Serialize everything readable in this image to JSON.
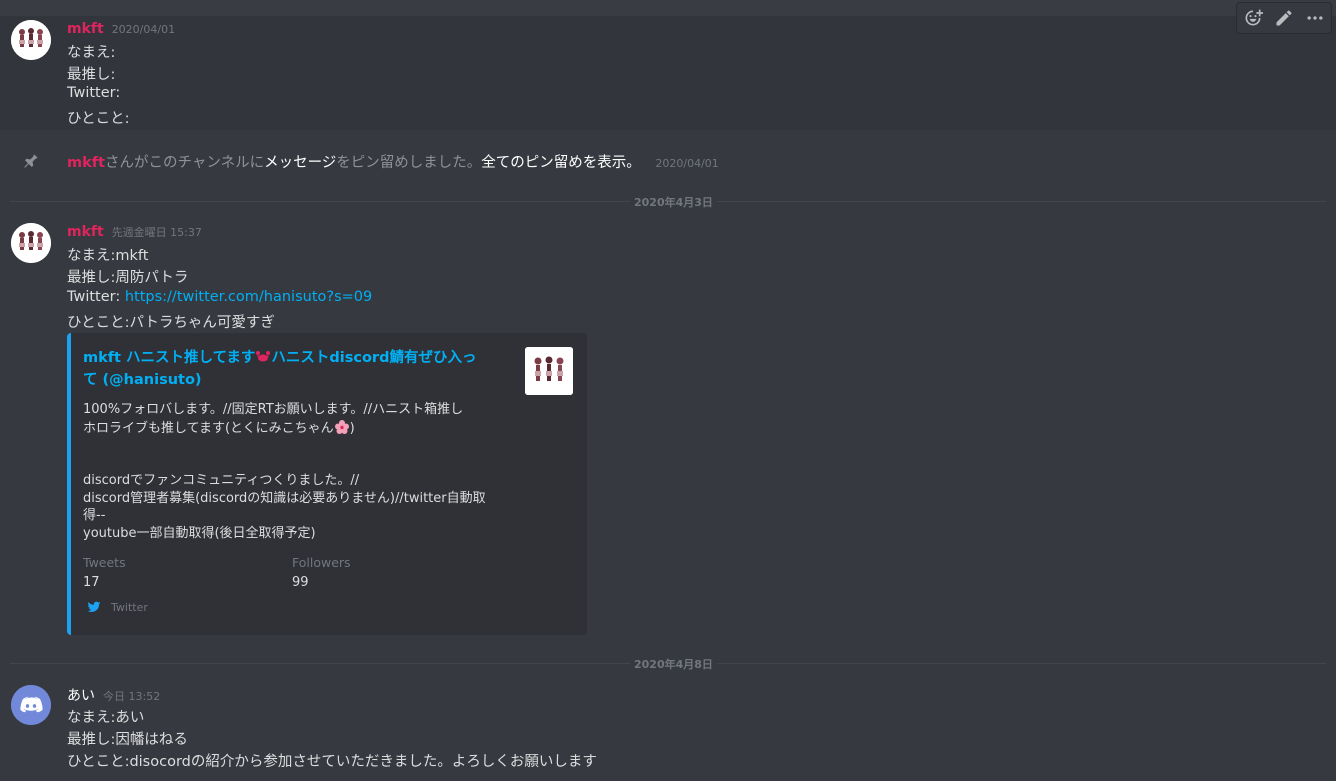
{
  "colors": {
    "background": "#36393f",
    "mkft_name": "#e0245e",
    "link": "#00b0f4",
    "twitter_accent": "#1da1f2"
  },
  "toolbar": {
    "icons": [
      "add-reaction-icon",
      "edit-icon",
      "more-icon"
    ]
  },
  "messages": [
    {
      "username": "mkft",
      "timestamp": "2020/04/01",
      "lines": [
        "なまえ:",
        "最推し:",
        "Twitter:",
        "ひとこと:"
      ]
    },
    {
      "username": "mkft",
      "timestamp": "先週金曜日 15:37",
      "line1": "なまえ:mkft",
      "line2": "最推し:周防パトラ",
      "line3_prefix": "Twitter: ",
      "line3_link": "https://twitter.com/hanisuto?s=09",
      "line4": "ひとこと:パトラちゃん可愛すぎ"
    },
    {
      "username": "あい",
      "timestamp": "今日 13:52",
      "lines": [
        "なまえ:あい",
        "最推し:因幡はねる",
        "ひとこと:disocordの紹介から参加させていただきました。よろしくお願いします"
      ]
    }
  ],
  "system": {
    "username": "mkft",
    "text1": "さんがこのチャンネルに",
    "link1": "メッセージ",
    "text2": "をピン留めしました。",
    "link2": "全てのピン留めを表示。",
    "timestamp": "2020/04/01"
  },
  "dividers": [
    "2020年4月3日",
    "2020年4月8日"
  ],
  "embed": {
    "title_author": "mkft",
    "title_text": "ハニスト推してます🦀ハニストdiscord鯖有ぜひ入って (@hanisuto)",
    "title_part1": " ハニスト推してます",
    "title_part2": "ハニストdiscord鯖有ぜひ入っ",
    "title_part3": "て (@hanisuto)",
    "desc1": "100%フォロバします。//固定RTお願いします。//ハニスト箱推し",
    "desc2": "ホロライブも推してます(とくにみこちゃん",
    "desc2_end": ")",
    "desc3": "discordでファンコミュニティつくりました。//",
    "desc4": "discord管理者募集(discordの知識は必要ありません)//twitter自動取",
    "desc5": "得--",
    "desc6": "youtube一部自動取得(後日全取得予定)",
    "fields": [
      {
        "name": "Tweets",
        "value": "17"
      },
      {
        "name": "Followers",
        "value": "99"
      }
    ],
    "footer": "Twitter"
  }
}
